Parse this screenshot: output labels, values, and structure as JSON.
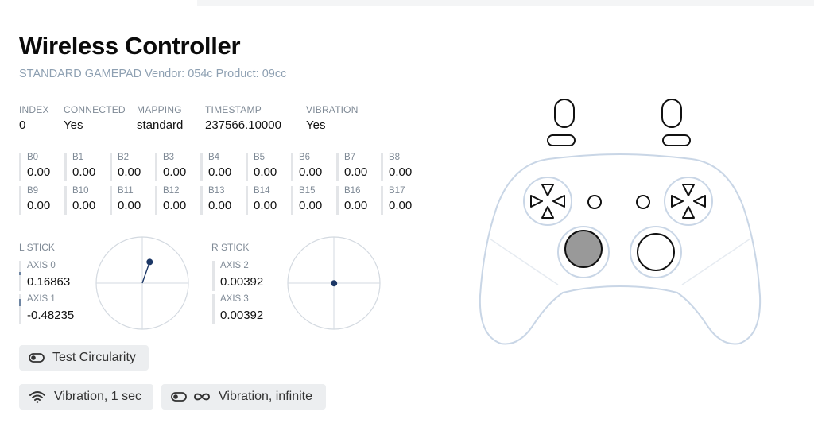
{
  "header": {
    "title": "Wireless Controller",
    "subtitle": "STANDARD GAMEPAD Vendor: 054c Product: 09cc"
  },
  "info": [
    {
      "label": "INDEX",
      "value": "0"
    },
    {
      "label": "CONNECTED",
      "value": "Yes"
    },
    {
      "label": "MAPPING",
      "value": "standard"
    },
    {
      "label": "TIMESTAMP",
      "value": "237566.10000"
    },
    {
      "label": "VIBRATION",
      "value": "Yes"
    }
  ],
  "buttons": [
    {
      "label": "B0",
      "value": "0.00"
    },
    {
      "label": "B1",
      "value": "0.00"
    },
    {
      "label": "B2",
      "value": "0.00"
    },
    {
      "label": "B3",
      "value": "0.00"
    },
    {
      "label": "B4",
      "value": "0.00"
    },
    {
      "label": "B5",
      "value": "0.00"
    },
    {
      "label": "B6",
      "value": "0.00"
    },
    {
      "label": "B7",
      "value": "0.00"
    },
    {
      "label": "B8",
      "value": "0.00"
    },
    {
      "label": "B9",
      "value": "0.00"
    },
    {
      "label": "B10",
      "value": "0.00"
    },
    {
      "label": "B11",
      "value": "0.00"
    },
    {
      "label": "B12",
      "value": "0.00"
    },
    {
      "label": "B13",
      "value": "0.00"
    },
    {
      "label": "B14",
      "value": "0.00"
    },
    {
      "label": "B15",
      "value": "0.00"
    },
    {
      "label": "B16",
      "value": "0.00"
    },
    {
      "label": "B17",
      "value": "0.00"
    }
  ],
  "sticks": {
    "left": {
      "label": "L STICK",
      "axes": [
        {
          "label": "AXIS 0",
          "value": "0.16863"
        },
        {
          "label": "AXIS 1",
          "value": "-0.48235"
        }
      ]
    },
    "right": {
      "label": "R STICK",
      "axes": [
        {
          "label": "AXIS 2",
          "value": "0.00392"
        },
        {
          "label": "AXIS 3",
          "value": "0.00392"
        }
      ]
    }
  },
  "actions": {
    "test_circularity": "Test Circularity",
    "vibration_1sec": "Vibration, 1 sec",
    "vibration_infinite": "Vibration, infinite"
  },
  "colors": {
    "stick_dot": "#1c3766",
    "gamepad_outline": "#c9d6e6",
    "pressed_stick_fill": "#999999"
  },
  "icons": [
    "toggle-icon",
    "wifi-icon",
    "infinity-icon"
  ]
}
